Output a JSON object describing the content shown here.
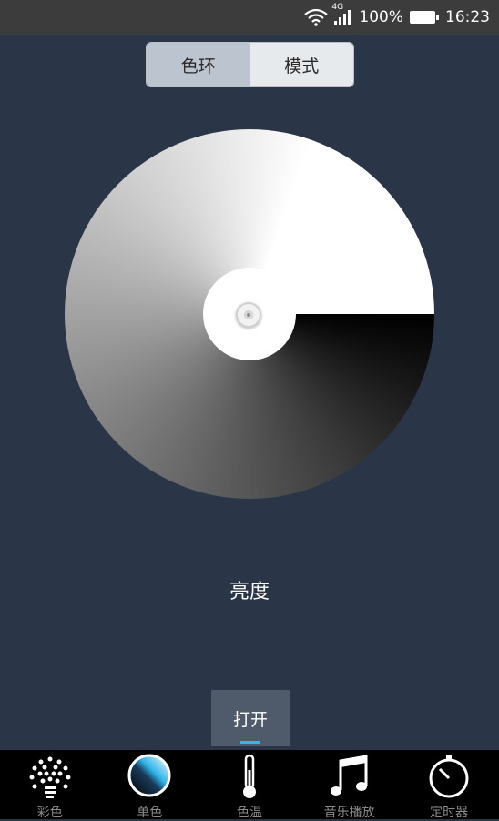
{
  "status_bar": {
    "network": "4G",
    "battery": "100%",
    "time": "16:23",
    "icons": [
      "wifi-icon",
      "signal-icon",
      "battery-icon"
    ]
  },
  "mode_switch": {
    "tabs": [
      {
        "label": "色环",
        "active": true
      },
      {
        "label": "模式",
        "active": false
      }
    ]
  },
  "main": {
    "brightness_label": "亮度",
    "toggle_button_label": "打开"
  },
  "bottom_nav": {
    "items": [
      {
        "label": "彩色",
        "icon": "bulb-rays-icon"
      },
      {
        "label": "单色",
        "icon": "mono-circle-icon"
      },
      {
        "label": "色温",
        "icon": "thermometer-icon"
      },
      {
        "label": "音乐播放",
        "icon": "music-note-icon"
      },
      {
        "label": "定时器",
        "icon": "timer-icon"
      }
    ]
  },
  "colors": {
    "background": "#2a3548",
    "status_bar": "#3c3c3c",
    "segment_active": "#bcc5cf",
    "segment_inactive": "#e6eaed",
    "button": "#4f5a6a",
    "accent": "#33b5e5",
    "nav_bar": "#000000"
  }
}
